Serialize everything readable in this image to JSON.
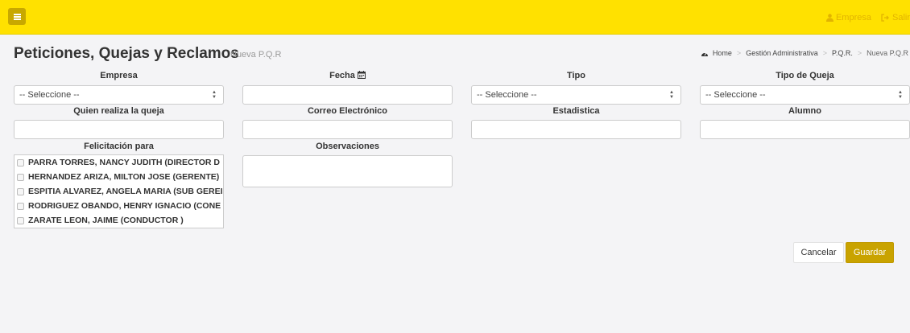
{
  "topbar": {
    "accent": "#ffe100",
    "menu_icon": "bars-icon",
    "empresa_label": "Empresa",
    "salir_label": "Salir"
  },
  "header": {
    "title": "Peticiones, Quejas y Reclamos",
    "subtitle": "Nueva P.Q.R",
    "breadcrumb": [
      "Home",
      "Gestión Administrativa",
      "P.Q.R.",
      "Nueva P.Q.R"
    ]
  },
  "form": {
    "empresa": {
      "label": "Empresa",
      "value": "-- Seleccione --"
    },
    "fecha": {
      "label": "Fecha",
      "value": ""
    },
    "tipo": {
      "label": "Tipo",
      "value": "-- Seleccione --"
    },
    "tipo_queja": {
      "label": "Tipo de Queja",
      "value": "-- Seleccione --"
    },
    "quien": {
      "label": "Quien realiza la queja",
      "value": ""
    },
    "correo": {
      "label": "Correo Electrónico",
      "value": ""
    },
    "estadistica": {
      "label": "Estadistica",
      "value": ""
    },
    "alumno": {
      "label": "Alumno",
      "value": ""
    },
    "felicitacion": {
      "label": "Felicitación para",
      "items": [
        "PARRA TORRES, NANCY JUDITH (DIRECTOR D",
        "HERNANDEZ ARIZA, MILTON JOSE (GERENTE)",
        "ESPITIA ALVAREZ, ANGELA MARIA (SUB GEREI",
        "RODRIGUEZ OBANDO, HENRY IGNACIO (CONE",
        "ZARATE LEON, JAIME (CONDUCTOR )"
      ]
    },
    "observaciones": {
      "label": "Observaciones",
      "value": ""
    }
  },
  "actions": {
    "cancel_label": "Cancelar",
    "save_label": "Guardar",
    "save_color": "#c9a300"
  }
}
